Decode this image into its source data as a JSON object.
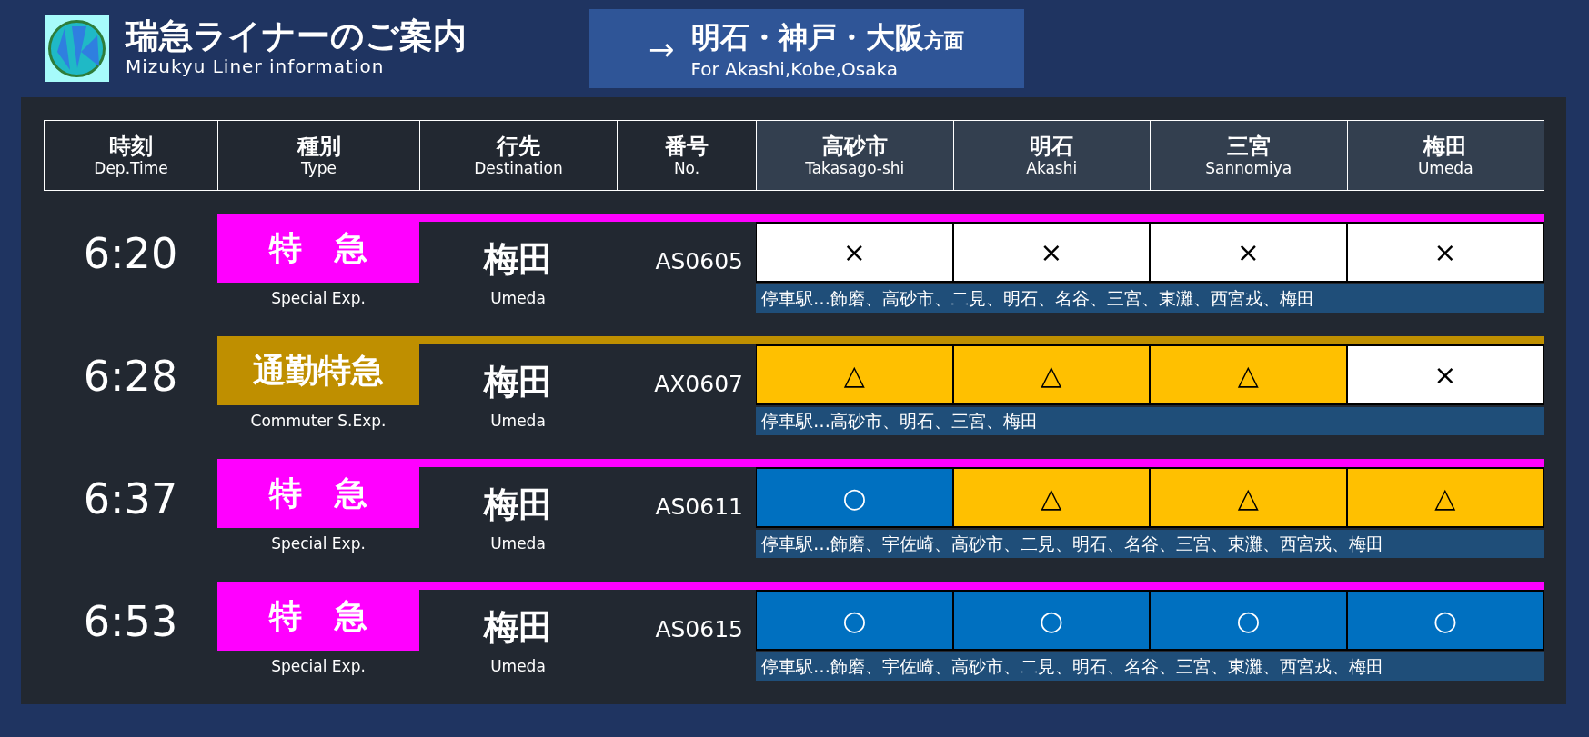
{
  "header": {
    "title": "瑞急ライナーのご案内",
    "subtitle": "Mizukyu Liner information"
  },
  "direction": {
    "arrow": "→",
    "destination": "明石・神戸・大阪",
    "suffix": "方面",
    "english": "For Akashi,Kobe,Osaka"
  },
  "table": {
    "columns": [
      {
        "label": "時刻",
        "english": "Dep.Time",
        "kind": "info"
      },
      {
        "label": "種別",
        "english": "Type",
        "kind": "info"
      },
      {
        "label": "行先",
        "english": "Destination",
        "kind": "info"
      },
      {
        "label": "番号",
        "english": "No.",
        "kind": "info"
      },
      {
        "label": "高砂市",
        "english": "Takasago-shi",
        "kind": "station"
      },
      {
        "label": "明石",
        "english": "Akashi",
        "kind": "station"
      },
      {
        "label": "三宮",
        "english": "Sannomiya",
        "kind": "station"
      },
      {
        "label": "梅田",
        "english": "Umeda",
        "kind": "station"
      }
    ],
    "rows": [
      {
        "time": "6:20",
        "type": "特　急",
        "type_english": "Special Exp.",
        "color": "#ff00ff",
        "destination": "梅田",
        "destination_english": "Umeda",
        "number": "AS0605",
        "seats": [
          {
            "kind": "none",
            "mark": "×"
          },
          {
            "kind": "none",
            "mark": "×"
          },
          {
            "kind": "none",
            "mark": "×"
          },
          {
            "kind": "none",
            "mark": "×"
          }
        ],
        "stops": "停車駅…飾磨、高砂市、二見、明石、名谷、三宮、東灘、西宮戎、梅田"
      },
      {
        "time": "6:28",
        "type": "通勤特急",
        "type_english": "Commuter S.Exp.",
        "color": "#bf8f00",
        "destination": "梅田",
        "destination_english": "Umeda",
        "number": "AX0607",
        "seats": [
          {
            "kind": "few",
            "mark": "△"
          },
          {
            "kind": "few",
            "mark": "△"
          },
          {
            "kind": "few",
            "mark": "△"
          },
          {
            "kind": "none",
            "mark": "×"
          }
        ],
        "stops": "停車駅…高砂市、明石、三宮、梅田"
      },
      {
        "time": "6:37",
        "type": "特　急",
        "type_english": "Special Exp.",
        "color": "#ff00ff",
        "destination": "梅田",
        "destination_english": "Umeda",
        "number": "AS0611",
        "seats": [
          {
            "kind": "available",
            "mark": "○"
          },
          {
            "kind": "few",
            "mark": "△"
          },
          {
            "kind": "few",
            "mark": "△"
          },
          {
            "kind": "few",
            "mark": "△"
          }
        ],
        "stops": "停車駅…飾磨、宇佐崎、高砂市、二見、明石、名谷、三宮、東灘、西宮戎、梅田"
      },
      {
        "time": "6:53",
        "type": "特　急",
        "type_english": "Special Exp.",
        "color": "#ff00ff",
        "destination": "梅田",
        "destination_english": "Umeda",
        "number": "AS0615",
        "seats": [
          {
            "kind": "available",
            "mark": "○"
          },
          {
            "kind": "available",
            "mark": "○"
          },
          {
            "kind": "available",
            "mark": "○"
          },
          {
            "kind": "available",
            "mark": "○"
          }
        ],
        "stops": "停車駅…飾磨、宇佐崎、高砂市、二見、明石、名谷、三宮、東灘、西宮戎、梅田"
      }
    ]
  }
}
